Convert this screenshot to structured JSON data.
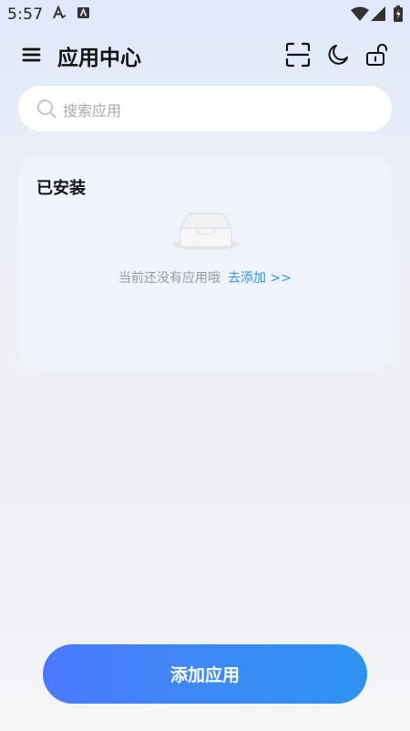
{
  "status_bar": {
    "time": "5:57",
    "icons": [
      "font-icon",
      "android-notification-icon",
      "wifi-icon",
      "cellular-signal-icon",
      "battery-icon"
    ]
  },
  "header": {
    "title": "应用中心",
    "menu_icon": "menu-icon",
    "actions": [
      "scan-icon",
      "dark-mode-icon",
      "unlock-icon"
    ]
  },
  "search": {
    "placeholder": "搜索应用",
    "icon": "search-icon"
  },
  "installed": {
    "title": "已安装",
    "empty_icon": "empty-inbox-icon",
    "empty_text": "当前还没有应用哦",
    "add_link": "去添加 >>"
  },
  "footer": {
    "add_button_label": "添加应用"
  },
  "colors": {
    "accent": "#3f8ed8",
    "button_gradient_start": "#4a7afd",
    "button_gradient_end": "#2e93f0",
    "card_bg": "#eff4fc"
  }
}
